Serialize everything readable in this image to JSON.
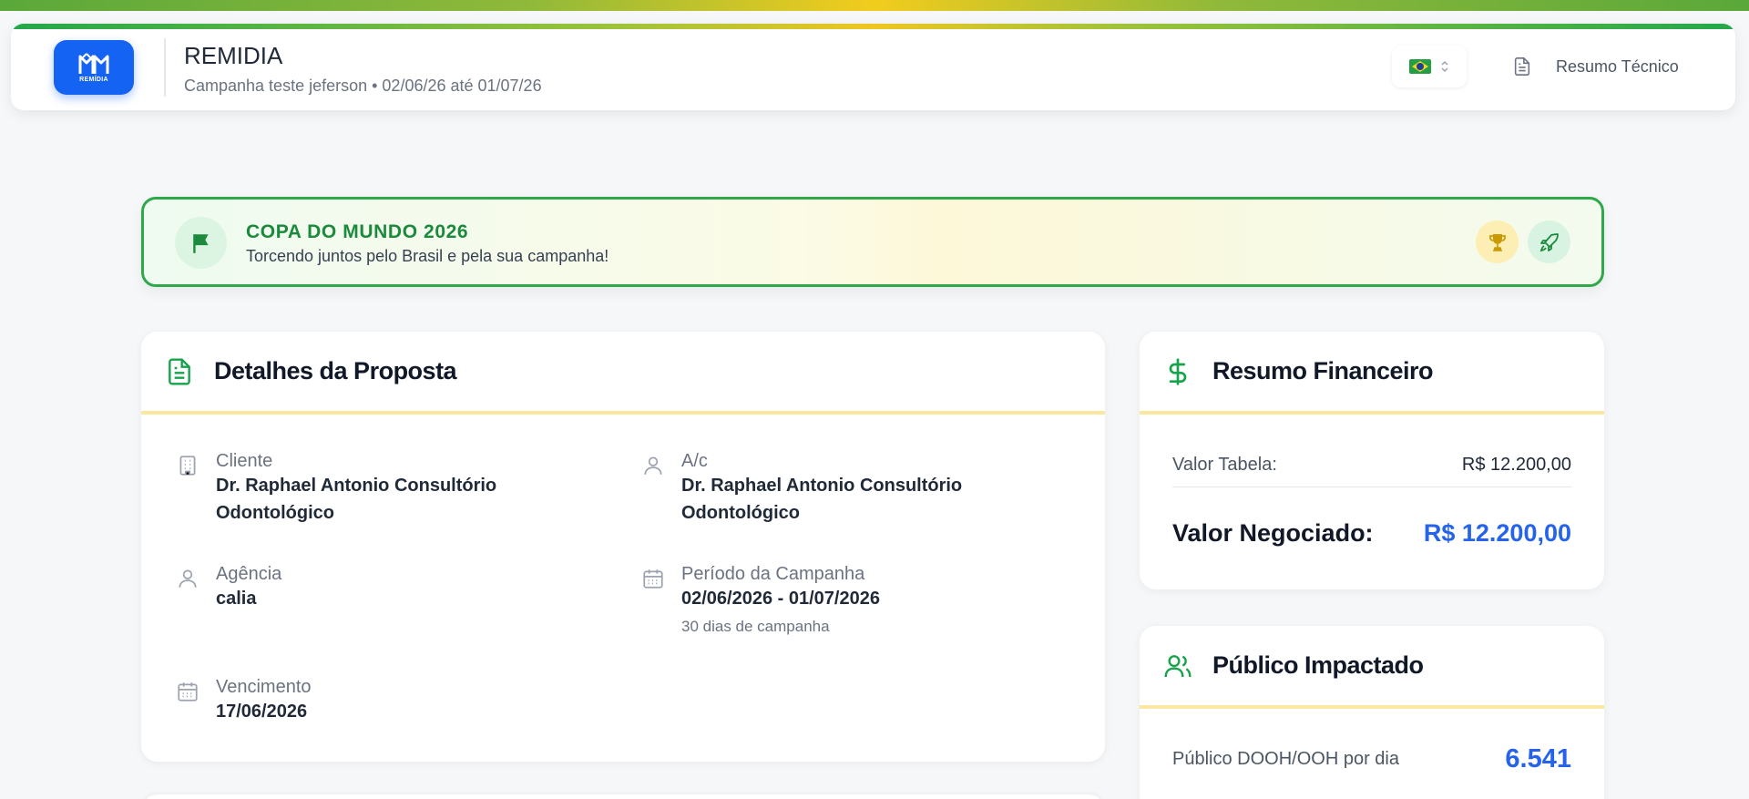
{
  "header": {
    "logo_text": "REMÍDIA",
    "title": "REMIDIA",
    "subtitle": "Campanha teste jeferson • 02/06/26 até 01/07/26",
    "language_icon": "brazil-flag-icon",
    "resumo_label": "Resumo Técnico"
  },
  "banner": {
    "title": "COPA DO MUNDO 2026",
    "subtitle": "Torcendo juntos pelo Brasil e pela sua campanha!"
  },
  "details": {
    "title": "Detalhes da Proposta",
    "cliente_label": "Cliente",
    "cliente_line1": "Dr. Raphael Antonio Consultório",
    "cliente_line2": "Odontológico",
    "ac_label": "A/c",
    "ac_line1": "Dr. Raphael Antonio Consultório",
    "ac_line2": "Odontológico",
    "agencia_label": "Agência",
    "agencia_value": "calia",
    "periodo_label": "Período da Campanha",
    "periodo_value": "02/06/2026 - 01/07/2026",
    "periodo_note": "30 dias de campanha",
    "vencimento_label": "Vencimento",
    "vencimento_value": "17/06/2026"
  },
  "financeiro": {
    "title": "Resumo Financeiro",
    "tabela_label": "Valor Tabela:",
    "tabela_value": "R$ 12.200,00",
    "negociado_label": "Valor Negociado:",
    "negociado_value": "R$ 12.200,00"
  },
  "publico": {
    "title": "Público Impactado",
    "dooh_label": "Público DOOH/OOH por dia",
    "dooh_value": "6.541"
  },
  "colors": {
    "brand_blue": "#1463f3",
    "green": "#1b8a3c",
    "accent_yellow": "#fbe7a0",
    "value_blue": "#2563eb"
  }
}
